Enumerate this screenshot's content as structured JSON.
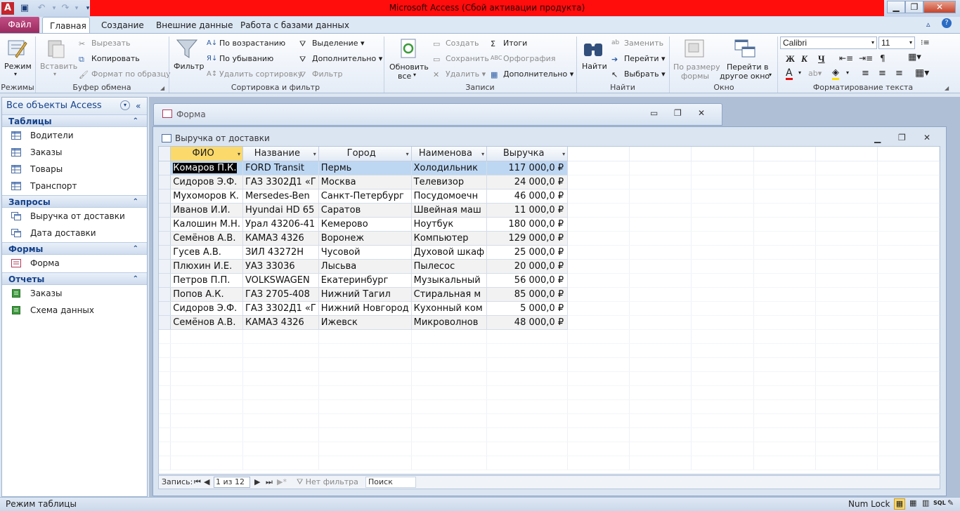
{
  "window": {
    "title": "Microsoft Access (Сбой активации продукта)"
  },
  "tabs": [
    "Файл",
    "Главная",
    "Создание",
    "Внешние данные",
    "Работа с базами данных"
  ],
  "ribbon": {
    "groups": [
      "Режимы",
      "Буфер обмена",
      "Сортировка и фильтр",
      "Записи",
      "Найти",
      "Окно",
      "Форматирование текста"
    ],
    "mode": "Режим",
    "paste": "Вставить",
    "cut": "Вырезать",
    "copy": "Копировать",
    "format_painter": "Формат по образцу",
    "filter": "Фильтр",
    "asc": "По возрастанию",
    "desc": "По убыванию",
    "remove_sort": "Удалить сортировку",
    "selection": "Выделение",
    "advanced": "Дополнительно",
    "toggle_filter": "Фильтр",
    "refresh1": "Обновить",
    "refresh2": "все",
    "new": "Создать",
    "save": "Сохранить",
    "delete": "Удалить",
    "totals": "Итоги",
    "spelling": "Орфография",
    "more": "Дополнительно",
    "find": "Найти",
    "replace": "Заменить",
    "goto": "Перейти",
    "select": "Выбрать",
    "fit1": "По размеру",
    "fit2": "формы",
    "switch1": "Перейти в",
    "switch2": "другое окно",
    "font": "Calibri",
    "size": "11"
  },
  "nav": {
    "header": "Все объекты Access",
    "sections": [
      {
        "title": "Таблицы",
        "items": [
          "Водители",
          "Заказы",
          "Товары",
          "Транспорт"
        ]
      },
      {
        "title": "Запросы",
        "items": [
          "Выручка от доставки",
          "Дата доставки"
        ]
      },
      {
        "title": "Формы",
        "items": [
          "Форма"
        ]
      },
      {
        "title": "Отчеты",
        "items": [
          "Заказы",
          "Схема данных"
        ]
      }
    ]
  },
  "form_window": {
    "title": "Форма"
  },
  "data_window": {
    "title": "Выручка от доставки"
  },
  "table": {
    "headers": [
      "ФИО",
      "Название",
      "Город",
      "Наименова",
      "Выручка"
    ],
    "rows": [
      [
        "Комаров П.К.",
        "FORD Transit",
        "Пермь",
        "Холодильник",
        "117 000,0 ₽"
      ],
      [
        "Сидоров Э.Ф.",
        "ГАЗ 3302Д1 «Г",
        "Москва",
        "Телевизор",
        "24 000,0 ₽"
      ],
      [
        "Мухоморов К.",
        "Mersedes-Ben",
        "Санкт-Петербург",
        "Посудомоечн",
        "46 000,0 ₽"
      ],
      [
        "Иванов И.И.",
        "Hyundai HD 65",
        "Саратов",
        "Швейная маш",
        "11 000,0 ₽"
      ],
      [
        "Калошин М.Н.",
        "Урал 43206-41",
        "Кемерово",
        "Ноутбук",
        "180 000,0 ₽"
      ],
      [
        "Семёнов А.В.",
        "КАМАЗ 4326",
        "Воронеж",
        "Компьютер",
        "129 000,0 ₽"
      ],
      [
        "Гусев А.В.",
        "ЗИЛ 43272Н",
        "Чусовой",
        "Духовой шкаф",
        "25 000,0 ₽"
      ],
      [
        "Плюхин И.Е.",
        "УАЗ 33036",
        "Лысьва",
        "Пылесос",
        "20 000,0 ₽"
      ],
      [
        "Петров П.П.",
        "VOLKSWAGEN",
        "Екатеринбург",
        "Музыкальный",
        "56 000,0 ₽"
      ],
      [
        "Попов А.К.",
        "ГАЗ 2705-408",
        "Нижний Тагил",
        "Стиральная м",
        "85 000,0 ₽"
      ],
      [
        "Сидоров Э.Ф.",
        "ГАЗ 3302Д1 «Г",
        "Нижний Новгород",
        "Кухонный ком",
        "5 000,0 ₽"
      ],
      [
        "Семёнов А.В.",
        "КАМАЗ 4326",
        "Ижевск",
        "Микроволнов",
        "48 000,0 ₽"
      ]
    ]
  },
  "recnav": {
    "label": "Запись:",
    "current": "1 из 12",
    "filter": "Нет фильтра",
    "search": "Поиск"
  },
  "status": {
    "left": "Режим таблицы",
    "numlock": "Num Lock"
  }
}
